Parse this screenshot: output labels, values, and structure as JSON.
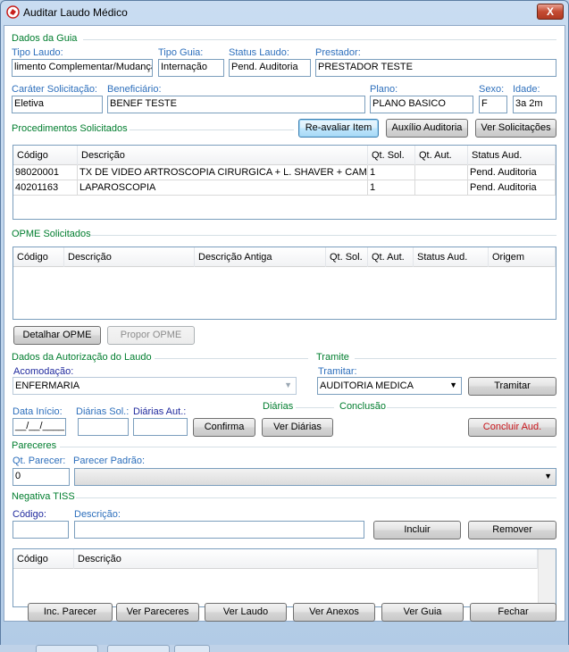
{
  "window": {
    "title": "Auditar Laudo Médico",
    "close_label": "X"
  },
  "dados_guia": {
    "section": "Dados da Guia",
    "tipo_laudo_label": "Tipo Laudo:",
    "tipo_laudo_value": "limento Complementar/Mudança",
    "tipo_guia_label": "Tipo Guia:",
    "tipo_guia_value": "Internação",
    "status_laudo_label": "Status Laudo:",
    "status_laudo_value": "Pend. Auditoria",
    "prestador_label": "Prestador:",
    "prestador_value": "PRESTADOR TESTE",
    "carater_label": "Caráter Solicitação:",
    "carater_value": "Eletiva",
    "beneficiario_label": "Beneficiário:",
    "beneficiario_value": "BENEF TESTE",
    "plano_label": "Plano:",
    "plano_value": "PLANO BASICO",
    "sexo_label": "Sexo:",
    "sexo_value": "F",
    "idade_label": "Idade:",
    "idade_value": "3a 2m"
  },
  "procedimentos": {
    "section": "Procedimentos Solicitados",
    "btn_reavaliar": "Re-avaliar Item",
    "btn_auxilio": "Auxílio Auditoria",
    "btn_ver_solicitacoes": "Ver Solicitações",
    "columns": [
      "Código",
      "Descrição",
      "Qt. Sol.",
      "Qt. Aut.",
      "Status Aud."
    ],
    "rows": [
      [
        "98020001",
        "TX DE VIDEO ARTROSCOPIA CIRURGICA + L. SHAVER + CAMI...",
        "1",
        "",
        "Pend. Auditoria"
      ],
      [
        "40201163",
        "LAPAROSCOPIA",
        "1",
        "",
        "Pend. Auditoria"
      ]
    ]
  },
  "opme": {
    "section": "OPME Solicitados",
    "columns": [
      "Código",
      "Descrição",
      "Descrição Antiga",
      "Qt. Sol.",
      "Qt. Aut.",
      "Status Aud.",
      "Origem"
    ],
    "btn_detalhar": "Detalhar OPME",
    "btn_propor": "Propor OPME"
  },
  "autorizacao": {
    "section": "Dados da Autorização do Laudo",
    "acomodacao_label": "Acomodação:",
    "acomodacao_value": "ENFERMARIA",
    "data_inicio_label": "Data Início:",
    "data_inicio_value": "__/__/____",
    "diarias_sol_label": "Diárias Sol.:",
    "diarias_sol_value": "",
    "diarias_aut_label": "Diárias Aut.:",
    "diarias_aut_value": "",
    "btn_confirma": "Confirma"
  },
  "tramite": {
    "section": "Tramite",
    "tramitar_label": "Tramitar:",
    "tramitar_value": "AUDITORIA MEDICA",
    "btn_tramitar": "Tramitar"
  },
  "diarias": {
    "section": "Diárias",
    "btn_ver": "Ver Diárias"
  },
  "conclusao": {
    "section": "Conclusão",
    "btn_concluir": "Concluir Aud."
  },
  "pareceres": {
    "section": "Pareceres",
    "qt_label": "Qt. Parecer:",
    "qt_value": "0",
    "padrao_label": "Parecer Padrão:",
    "padrao_value": ""
  },
  "negativa": {
    "section": "Negativa TISS",
    "codigo_label": "Código:",
    "codigo_value": "",
    "descricao_label": "Descrição:",
    "descricao_value": "",
    "btn_incluir": "Incluir",
    "btn_remover": "Remover",
    "columns": [
      "Código",
      "Descrição"
    ]
  },
  "footer": {
    "btn_inc_parecer": "Inc. Parecer",
    "btn_ver_pareceres": "Ver Pareceres",
    "btn_ver_laudo": "Ver Laudo",
    "btn_ver_anexos": "Ver Anexos",
    "btn_ver_guia": "Ver Guia",
    "btn_fechar": "Fechar"
  },
  "icons": {
    "app": "app-icon",
    "close": "close-icon",
    "dropdown": "chevron-down-icon"
  }
}
